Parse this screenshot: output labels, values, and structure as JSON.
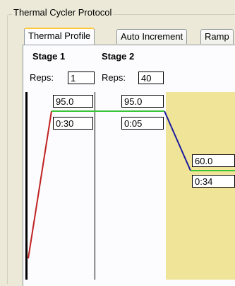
{
  "group": {
    "title": "Thermal Cycler Protocol"
  },
  "tabs": [
    {
      "label": "Thermal Profile",
      "active": true
    },
    {
      "label": "Auto Increment",
      "active": false
    },
    {
      "label": "Ramp",
      "active": false
    }
  ],
  "stages": [
    {
      "label": "Stage 1",
      "reps_label": "Reps:",
      "reps": "1",
      "steps": [
        {
          "temp": "95.0",
          "time": "0:30"
        }
      ]
    },
    {
      "label": "Stage 2",
      "reps_label": "Reps:",
      "reps": "40",
      "steps": [
        {
          "temp": "95.0",
          "time": "0:05"
        },
        {
          "temp": "60.0",
          "time": "0:34"
        }
      ]
    }
  ],
  "colors": {
    "ramp_up": "#C02020",
    "ramp_down": "#1A1AA0",
    "hold": "#3CC43C",
    "selected_step": "#F0E498"
  }
}
